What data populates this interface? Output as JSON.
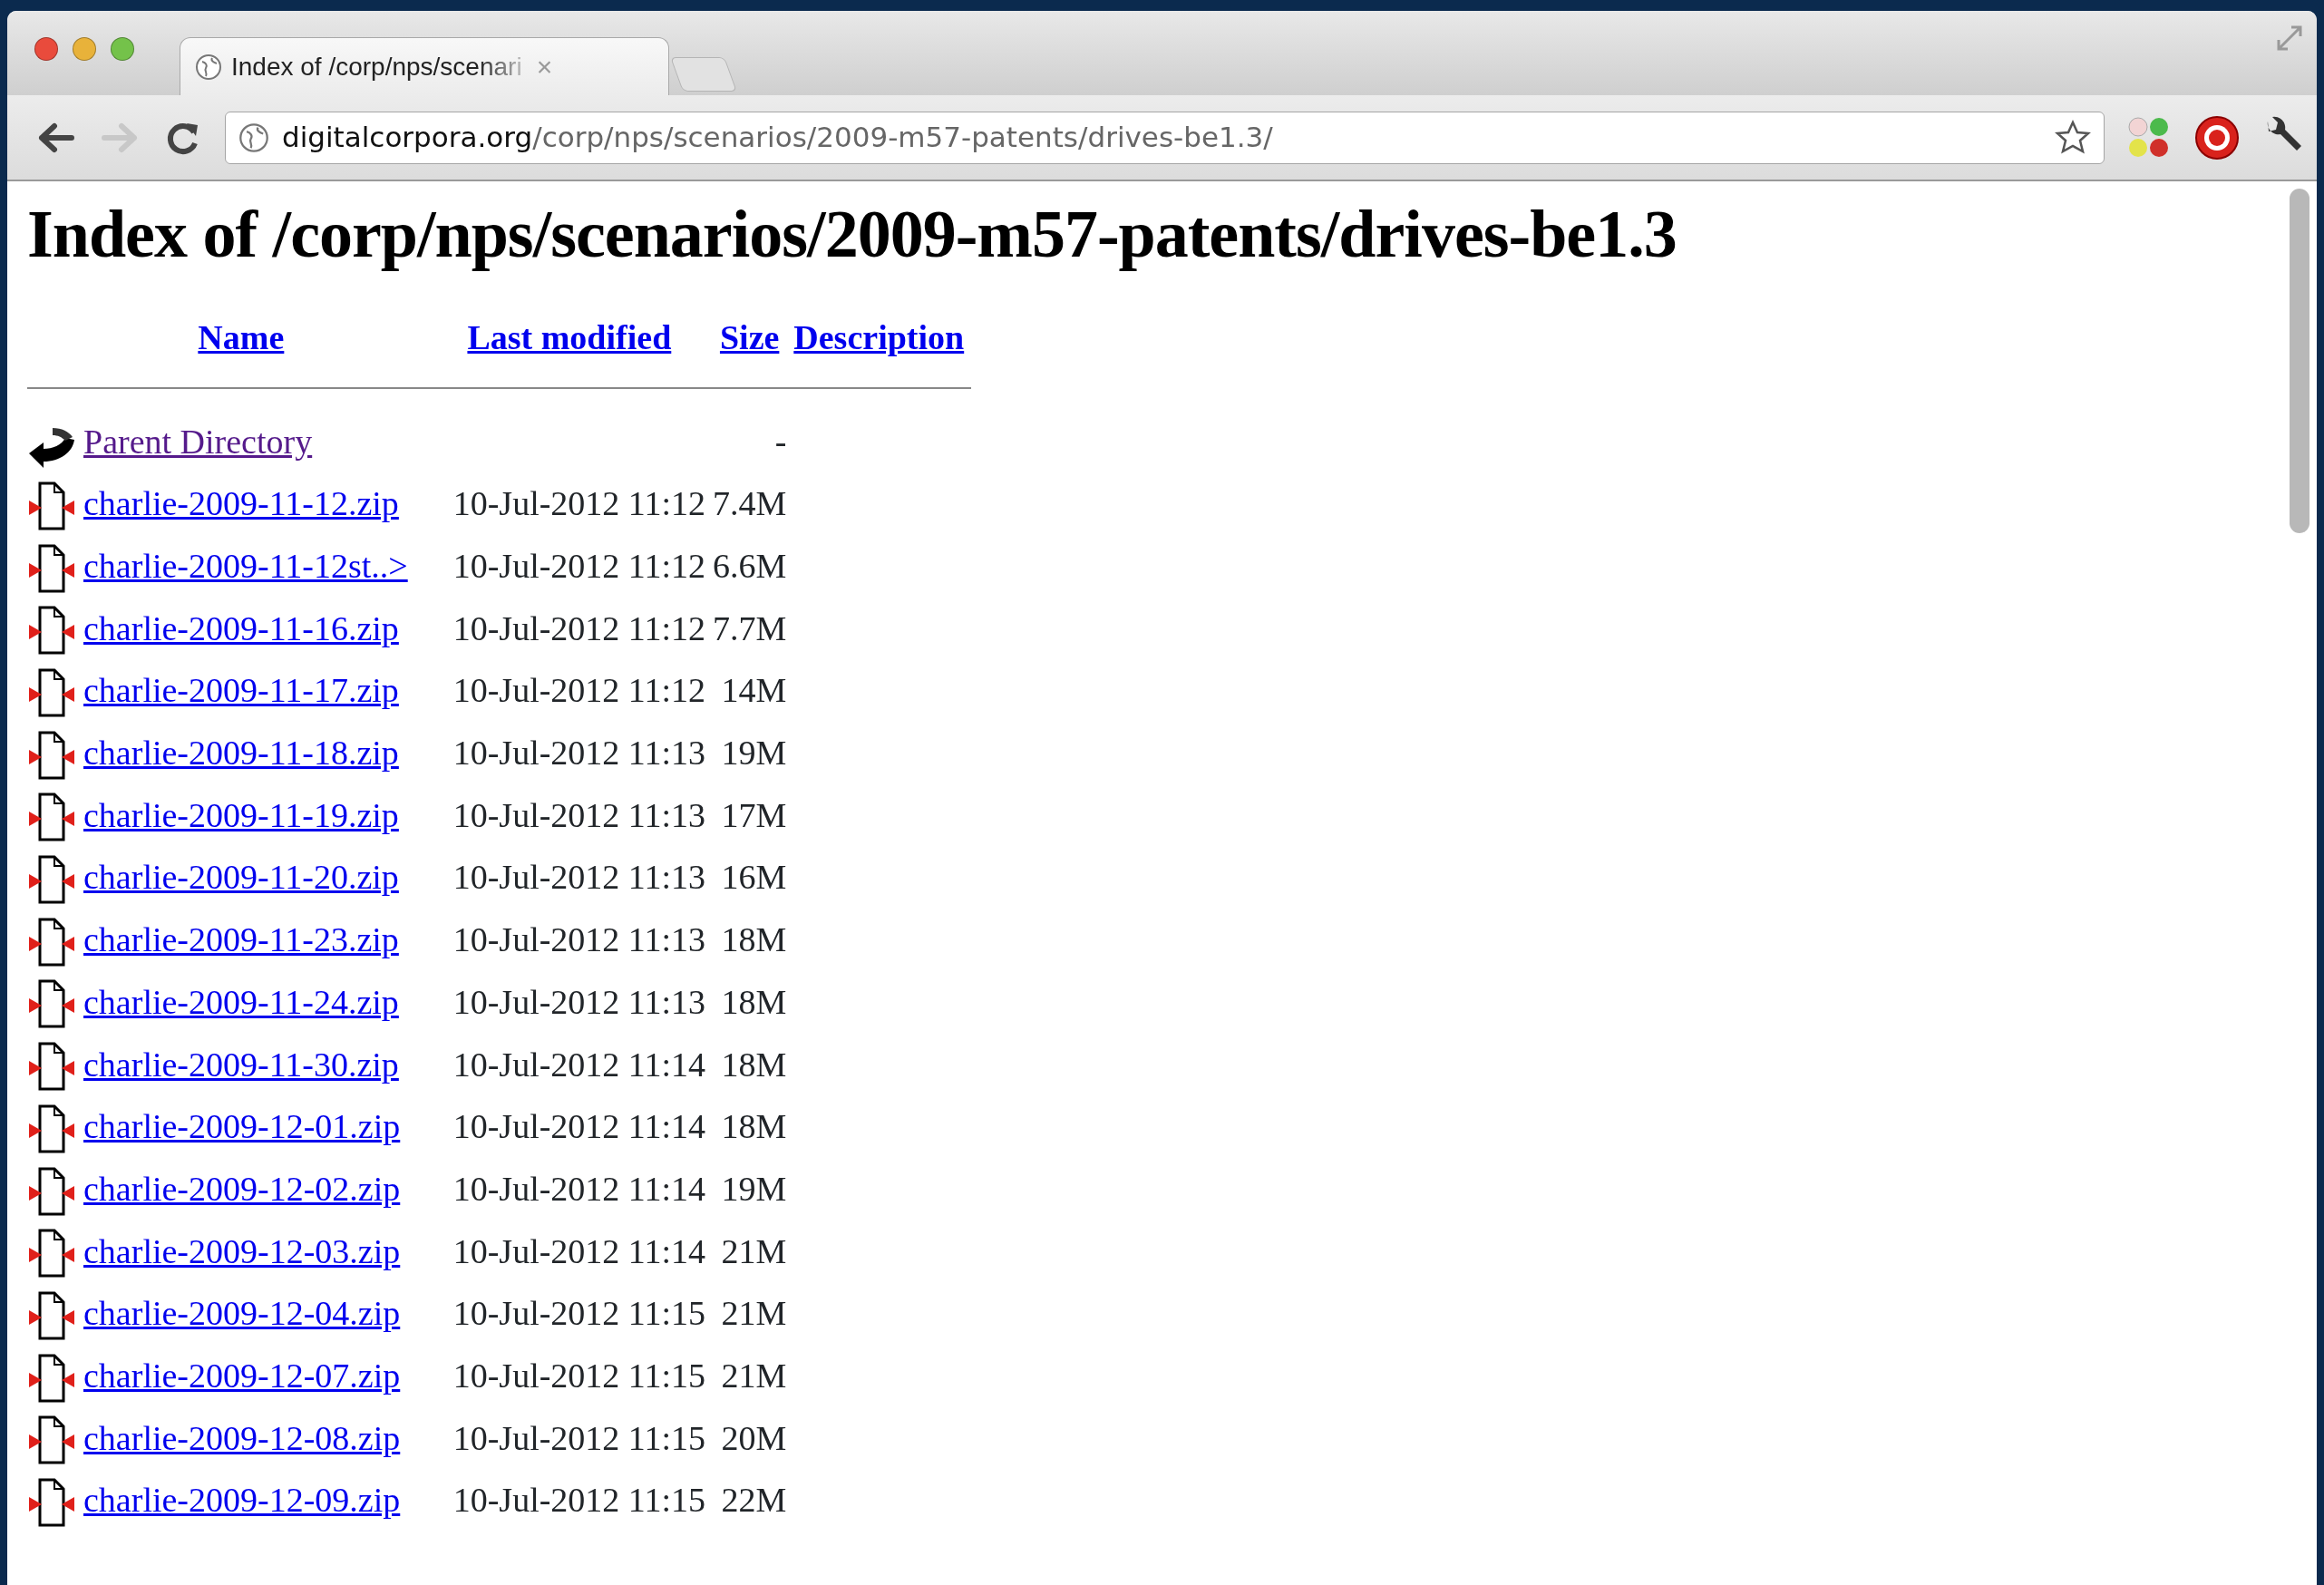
{
  "window": {
    "tab": {
      "title": "Index of /corp/nps/scenari",
      "close": "×"
    }
  },
  "toolbar": {
    "back_disabled": false,
    "forward_disabled": true,
    "url_domain": "digitalcorpora.org",
    "url_path": "/corp/nps/scenarios/2009-m57-patents/drives-be1.3/",
    "bookmarked": false
  },
  "page": {
    "heading": "Index of /corp/nps/scenarios/2009-m57-patents/drives-be1.3",
    "columns": [
      "Name",
      "Last modified",
      "Size",
      "Description"
    ],
    "rows": [
      {
        "kind": "parent",
        "name": "Parent Directory",
        "size": "-",
        "visited": true
      },
      {
        "kind": "zip",
        "name": "charlie-2009-11-12.zip",
        "modified": "10-Jul-2012 11:12",
        "size": "7.4M",
        "visited": false
      },
      {
        "kind": "zip",
        "name": "charlie-2009-11-12st..>",
        "modified": "10-Jul-2012 11:12",
        "size": "6.6M",
        "visited": false
      },
      {
        "kind": "zip",
        "name": "charlie-2009-11-16.zip",
        "modified": "10-Jul-2012 11:12",
        "size": "7.7M",
        "visited": false
      },
      {
        "kind": "zip",
        "name": "charlie-2009-11-17.zip",
        "modified": "10-Jul-2012 11:12",
        "size": "14M",
        "visited": false
      },
      {
        "kind": "zip",
        "name": "charlie-2009-11-18.zip",
        "modified": "10-Jul-2012 11:13",
        "size": "19M",
        "visited": false
      },
      {
        "kind": "zip",
        "name": "charlie-2009-11-19.zip",
        "modified": "10-Jul-2012 11:13",
        "size": "17M",
        "visited": false
      },
      {
        "kind": "zip",
        "name": "charlie-2009-11-20.zip",
        "modified": "10-Jul-2012 11:13",
        "size": "16M",
        "visited": false
      },
      {
        "kind": "zip",
        "name": "charlie-2009-11-23.zip",
        "modified": "10-Jul-2012 11:13",
        "size": "18M",
        "visited": false
      },
      {
        "kind": "zip",
        "name": "charlie-2009-11-24.zip",
        "modified": "10-Jul-2012 11:13",
        "size": "18M",
        "visited": false
      },
      {
        "kind": "zip",
        "name": "charlie-2009-11-30.zip",
        "modified": "10-Jul-2012 11:14",
        "size": "18M",
        "visited": false
      },
      {
        "kind": "zip",
        "name": "charlie-2009-12-01.zip",
        "modified": "10-Jul-2012 11:14",
        "size": "18M",
        "visited": false
      },
      {
        "kind": "zip",
        "name": "charlie-2009-12-02.zip",
        "modified": "10-Jul-2012 11:14",
        "size": "19M",
        "visited": false
      },
      {
        "kind": "zip",
        "name": "charlie-2009-12-03.zip",
        "modified": "10-Jul-2012 11:14",
        "size": "21M",
        "visited": false
      },
      {
        "kind": "zip",
        "name": "charlie-2009-12-04.zip",
        "modified": "10-Jul-2012 11:15",
        "size": "21M",
        "visited": false
      },
      {
        "kind": "zip",
        "name": "charlie-2009-12-07.zip",
        "modified": "10-Jul-2012 11:15",
        "size": "21M",
        "visited": false
      },
      {
        "kind": "zip",
        "name": "charlie-2009-12-08.zip",
        "modified": "10-Jul-2012 11:15",
        "size": "20M",
        "visited": false
      },
      {
        "kind": "zip",
        "name": "charlie-2009-12-09.zip",
        "modified": "10-Jul-2012 11:15",
        "size": "22M",
        "visited": false
      }
    ]
  }
}
